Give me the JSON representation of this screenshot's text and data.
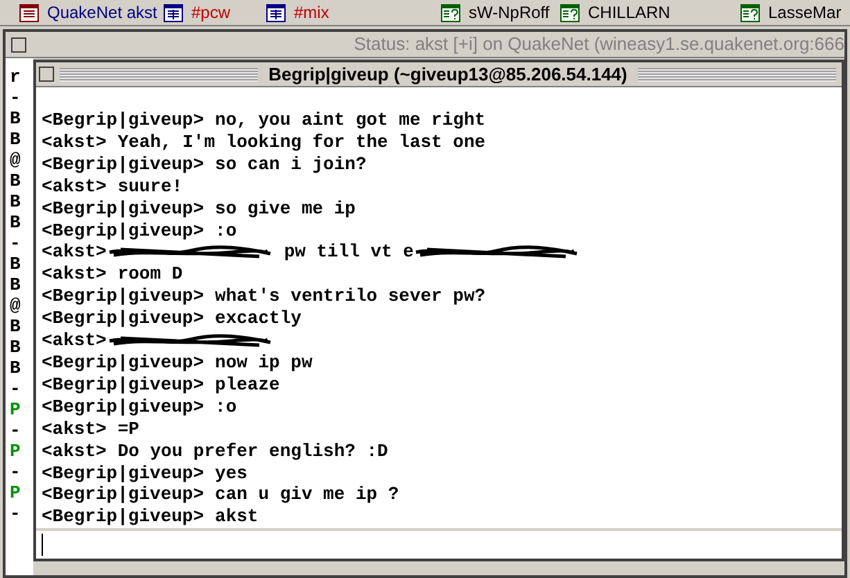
{
  "switchbar": [
    {
      "kind": "status",
      "label": "QuakeNet akst",
      "color": "#000080"
    },
    {
      "kind": "channel",
      "label": "#pcw",
      "color": "#c00000"
    },
    {
      "kind": "channel",
      "label": "#mix",
      "color": "#c00000"
    },
    {
      "kind": "query",
      "label": "sW-NpRoff",
      "color": "#000000"
    },
    {
      "kind": "query",
      "label": "CHILLARN",
      "color": "#000000"
    },
    {
      "kind": "query",
      "label": "LasseMar",
      "color": "#000000"
    }
  ],
  "status_window": {
    "title": "Status: akst [+i] on QuakeNet (wineasy1.se.quakenet.org:666",
    "lines": [
      {
        "text": "r",
        "color": "#000000"
      },
      {
        "text": "-",
        "color": "#000000"
      },
      {
        "text": "B",
        "color": "#000000"
      },
      {
        "text": "B",
        "color": "#000000"
      },
      {
        "text": "@",
        "color": "#000000"
      },
      {
        "text": "B",
        "color": "#000000"
      },
      {
        "text": "B",
        "color": "#000000"
      },
      {
        "text": "B",
        "color": "#000000"
      },
      {
        "text": "-",
        "color": "#000000"
      },
      {
        "text": "B",
        "color": "#000000"
      },
      {
        "text": "B",
        "color": "#000000"
      },
      {
        "text": "@",
        "color": "#000000"
      },
      {
        "text": "B",
        "color": "#000000"
      },
      {
        "text": "B",
        "color": "#000000"
      },
      {
        "text": "B",
        "color": "#000000"
      },
      {
        "text": "-",
        "color": "#000000"
      },
      {
        "text": "P",
        "color": "#009300"
      },
      {
        "text": "-",
        "color": "#000000"
      },
      {
        "text": "P",
        "color": "#009300"
      },
      {
        "text": "-",
        "color": "#000000"
      },
      {
        "text": "P",
        "color": "#009300"
      },
      {
        "text": "-",
        "color": "#000000"
      }
    ]
  },
  "query_window": {
    "title": "Begrip|giveup (~giveup13@85.206.54.144)",
    "lines": [
      {
        "nick": "<Begrip|giveup>",
        "parts": [
          {
            "kind": "text",
            "text": "no, you aint got me right"
          }
        ]
      },
      {
        "nick": "<akst>",
        "parts": [
          {
            "kind": "text",
            "text": "Yeah, I'm looking for the last one"
          }
        ]
      },
      {
        "nick": "<Begrip|giveup>",
        "parts": [
          {
            "kind": "text",
            "text": "so can i join?"
          }
        ]
      },
      {
        "nick": "<akst>",
        "parts": [
          {
            "kind": "text",
            "text": "suure!"
          }
        ]
      },
      {
        "nick": "<Begrip|giveup>",
        "parts": [
          {
            "kind": "text",
            "text": "so give me ip"
          }
        ]
      },
      {
        "nick": "<Begrip|giveup>",
        "parts": [
          {
            "kind": "text",
            "text": ":o"
          }
        ]
      },
      {
        "nick": "<akst>",
        "parts": [
          {
            "kind": "scribble"
          },
          {
            "kind": "text",
            "text": "pw till vt e"
          },
          {
            "kind": "scribble"
          }
        ]
      },
      {
        "nick": "<akst>",
        "parts": [
          {
            "kind": "text",
            "text": "room D"
          }
        ]
      },
      {
        "nick": "<Begrip|giveup>",
        "parts": [
          {
            "kind": "text",
            "text": "what's ventrilo sever pw?"
          }
        ]
      },
      {
        "nick": "<Begrip|giveup>",
        "parts": [
          {
            "kind": "text",
            "text": "excactly"
          }
        ]
      },
      {
        "nick": "<akst>",
        "parts": [
          {
            "kind": "scribble"
          }
        ]
      },
      {
        "nick": "<Begrip|giveup>",
        "parts": [
          {
            "kind": "text",
            "text": "now ip pw"
          }
        ]
      },
      {
        "nick": "<Begrip|giveup>",
        "parts": [
          {
            "kind": "text",
            "text": "pleaze"
          }
        ]
      },
      {
        "nick": "<Begrip|giveup>",
        "parts": [
          {
            "kind": "text",
            "text": ":o"
          }
        ]
      },
      {
        "nick": "<akst>",
        "parts": [
          {
            "kind": "text",
            "text": "=P"
          }
        ]
      },
      {
        "nick": "<akst>",
        "parts": [
          {
            "kind": "text",
            "text": "Do you prefer english? :D"
          }
        ]
      },
      {
        "nick": "<Begrip|giveup>",
        "parts": [
          {
            "kind": "text",
            "text": "yes"
          }
        ]
      },
      {
        "nick": "<Begrip|giveup>",
        "parts": [
          {
            "kind": "text",
            "text": "can u giv me ip ?"
          }
        ]
      },
      {
        "nick": "<Begrip|giveup>",
        "parts": [
          {
            "kind": "text",
            "text": "akst"
          }
        ]
      }
    ]
  }
}
